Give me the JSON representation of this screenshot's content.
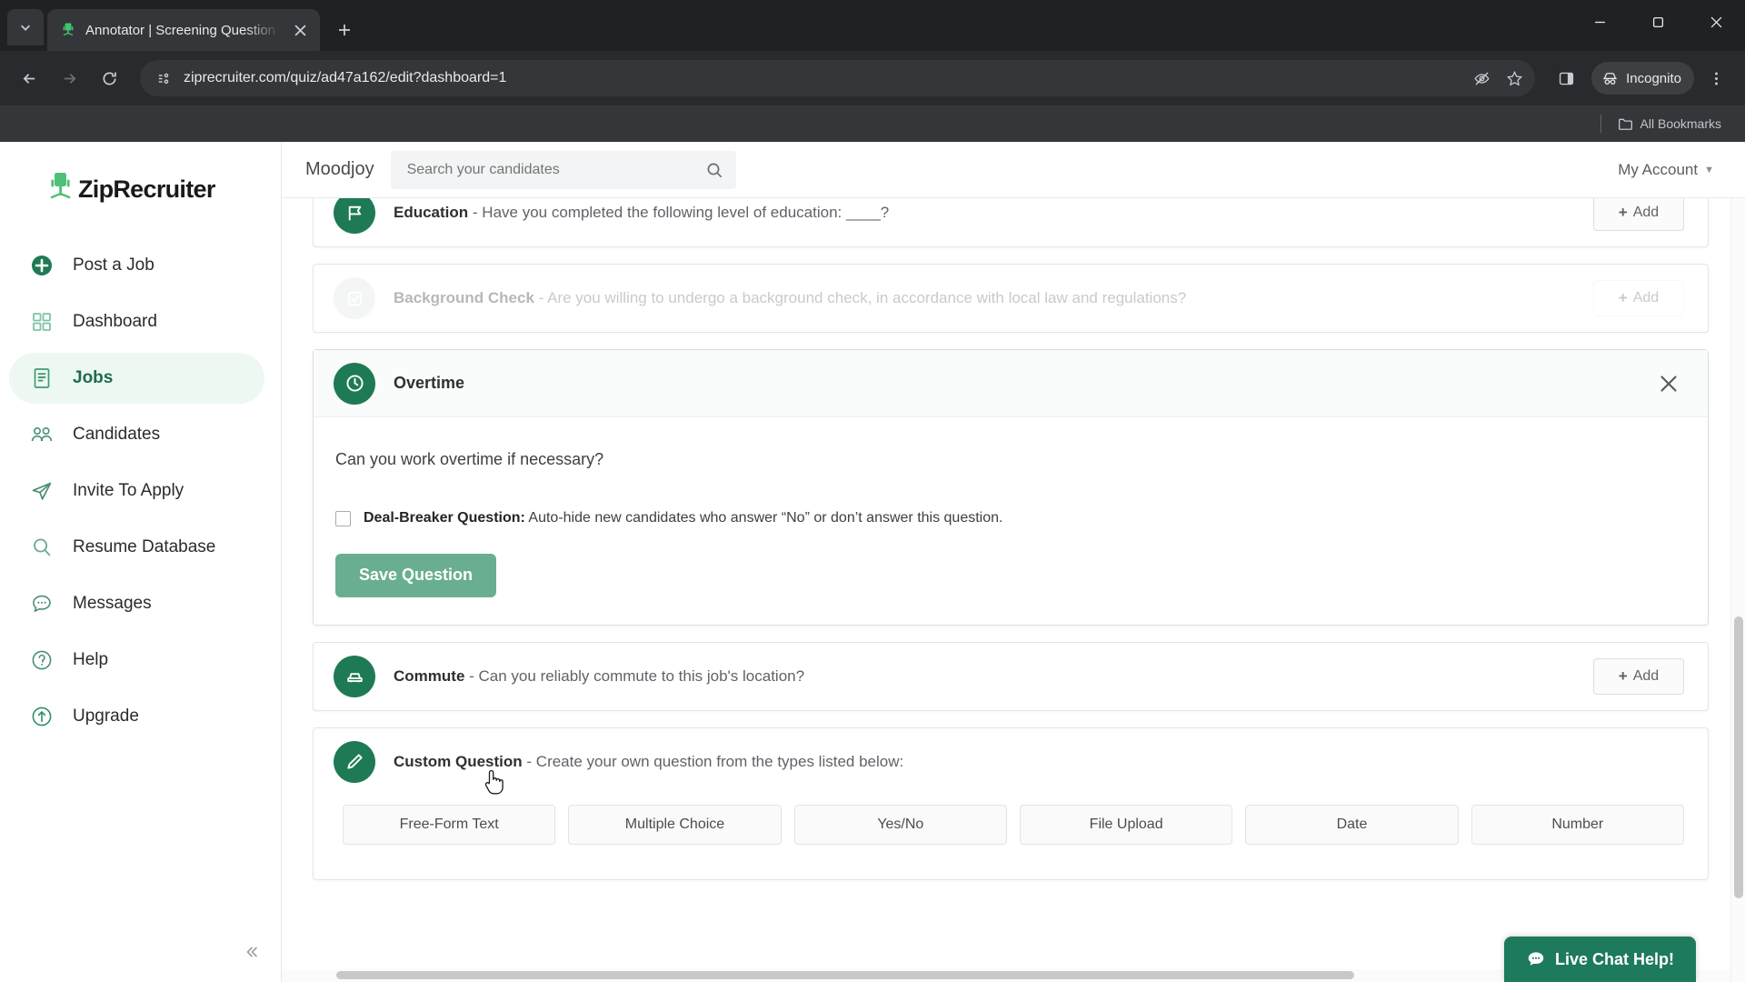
{
  "browser": {
    "tab": {
      "title": "Annotator | Screening Question",
      "favicon_icon": "ziprecruiter-chair-icon"
    },
    "new_tab_label": "+",
    "url": "ziprecruiter.com/quiz/ad47a162/edit?dashboard=1",
    "incognito_label": "Incognito",
    "bookmarks_label": "All Bookmarks",
    "icons": {
      "tab_list": "chevron-down-icon",
      "tab_close": "close-icon",
      "back": "back-arrow-icon",
      "forward": "forward-arrow-icon",
      "reload": "reload-icon",
      "site_info": "page-info-icon",
      "tracking": "eye-off-icon",
      "bookmark": "star-icon",
      "side_panel": "side-panel-icon",
      "incognito": "incognito-hat-icon",
      "menu": "three-dot-menu-icon",
      "minimize": "minimize-icon",
      "maximize": "maximize-icon",
      "close_window": "window-close-icon",
      "folder": "folder-icon"
    }
  },
  "sidebar": {
    "logo_text": "ZipRecruiter",
    "logo_mark": "green-office-chair-icon",
    "collapse_icon": "double-chevron-left-icon",
    "items": [
      {
        "label": "Post a Job",
        "icon": "plus-circle-icon",
        "active": false
      },
      {
        "label": "Dashboard",
        "icon": "grid-dashboard-icon",
        "active": false
      },
      {
        "label": "Jobs",
        "icon": "document-list-icon",
        "active": true
      },
      {
        "label": "Candidates",
        "icon": "people-group-icon",
        "active": false
      },
      {
        "label": "Invite To Apply",
        "icon": "paper-plane-icon",
        "active": false
      },
      {
        "label": "Resume Database",
        "icon": "magnifier-icon",
        "active": false
      },
      {
        "label": "Messages",
        "icon": "chat-bubble-icon",
        "active": false
      },
      {
        "label": "Help",
        "icon": "question-circle-icon",
        "active": false
      },
      {
        "label": "Upgrade",
        "icon": "up-arrow-circle-icon",
        "active": false
      }
    ]
  },
  "appheader": {
    "brand": "Moodjoy",
    "search_placeholder": "Search your candidates",
    "search_value": "",
    "search_icon": "magnifier-icon",
    "account_label": "My Account",
    "account_chevron": "chevron-down-icon"
  },
  "questions": [
    {
      "id": "education",
      "title": "Education",
      "description": "- Have you completed the following level of education: ____?",
      "icon": "education-flag-icon",
      "add_label": "Add",
      "disabled": false
    },
    {
      "id": "background-check",
      "title": "Background Check",
      "description": "- Are you willing to undergo a background check, in accordance with local law and regulations?",
      "icon": "checkbox-shield-icon",
      "add_label": "Add",
      "disabled": true
    }
  ],
  "expanded_card": {
    "title": "Overtime",
    "icon": "clock-icon",
    "close_icon": "close-x-icon",
    "question": "Can you work overtime if necessary?",
    "dealbreaker_bold": "Deal-Breaker Question:",
    "dealbreaker_rest": " Auto-hide new candidates who answer “No” or don’t answer this question.",
    "dealbreaker_checked": false,
    "save_label": "Save Question",
    "save_color": "#6aae91"
  },
  "questions_after": [
    {
      "id": "commute",
      "title": "Commute",
      "description": "- Can you reliably commute to this job's location?",
      "icon": "car-icon",
      "add_label": "Add",
      "disabled": false
    }
  ],
  "custom_question": {
    "title": "Custom Question",
    "description": "- Create your own question from the types listed below:",
    "icon": "pencil-icon",
    "types": [
      "Free-Form Text",
      "Multiple Choice",
      "Yes/No",
      "File Upload",
      "Date",
      "Number"
    ]
  },
  "live_chat": {
    "label": "Live Chat Help!",
    "icon": "chat-bubble-icon",
    "color": "#1e7a5c"
  }
}
